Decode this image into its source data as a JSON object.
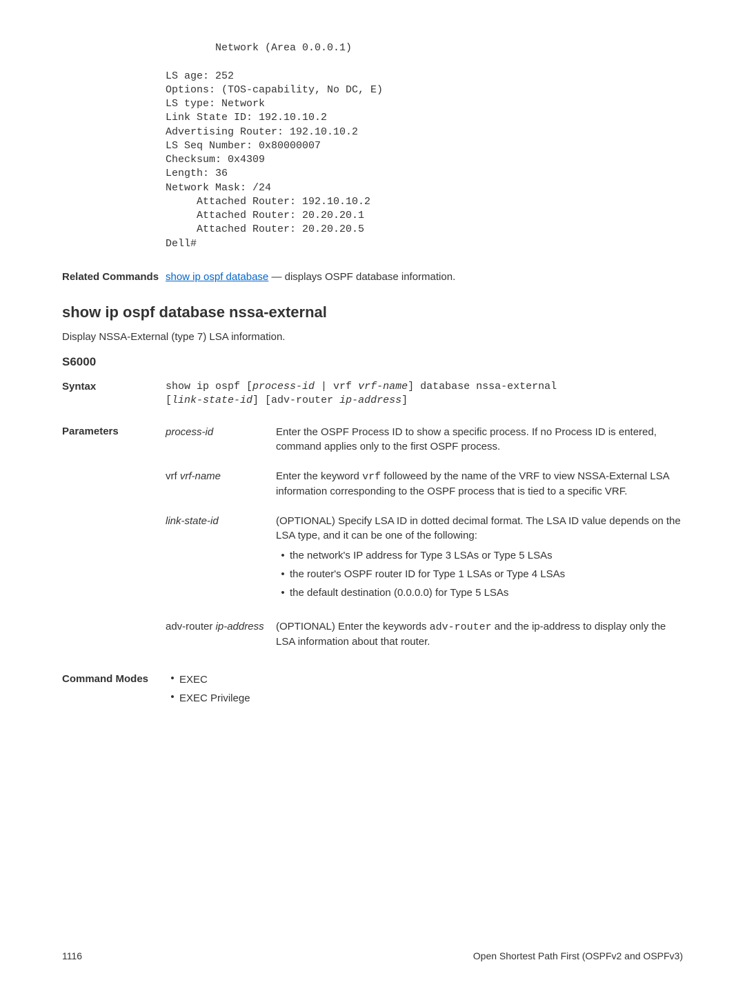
{
  "codeBlock": "        Network (Area 0.0.0.1)\n\nLS age: 252\nOptions: (TOS-capability, No DC, E)\nLS type: Network\nLink State ID: 192.10.10.2\nAdvertising Router: 192.10.10.2\nLS Seq Number: 0x80000007\nChecksum: 0x4309\nLength: 36\nNetwork Mask: /24\n     Attached Router: 192.10.10.2\n     Attached Router: 20.20.20.1\n     Attached Router: 20.20.20.5\nDell#",
  "related": {
    "label": "Related Commands",
    "linkText": "show ip ospf database",
    "restText": " — displays OSPF database information."
  },
  "section": {
    "heading": "show ip ospf database nssa-external",
    "desc": "Display NSSA-External (type 7) LSA information.",
    "subheading": "S6000"
  },
  "syntax": {
    "label": "Syntax",
    "part1": "show ip ospf [",
    "part2_italic": "process-id",
    "part3": " | vrf ",
    "part4_italic": "vrf-name",
    "part5": "] database nssa-external",
    "line2a": "[",
    "line2b_italic": "link-state-id",
    "line2c": "] [adv-router ",
    "line2d_italic": "ip-address",
    "line2e": "]"
  },
  "parameters": {
    "label": "Parameters",
    "items": [
      {
        "nameItalic": "process-id",
        "desc": "Enter the OSPF Process ID to show a specific process. If no Process ID is entered, command applies only to the first OSPF process."
      },
      {
        "namePlain": "vrf ",
        "nameItalic": "vrf-name",
        "descPre": "Enter the keyword ",
        "descMono": "vrf",
        "descPost": " followeed by the name of the VRF to view NSSA-External LSA information corresponding to the OSPF process that is tied to a specific VRF."
      },
      {
        "nameItalic": "link-state-id",
        "desc": "(OPTIONAL) Specify LSA ID in dotted decimal format. The LSA ID value depends on the LSA type, and it can be one of the following:",
        "bullets": [
          "the network's IP address for Type 3 LSAs or Type 5 LSAs",
          "the router's OSPF router ID for Type 1 LSAs or Type 4 LSAs",
          "the default destination (0.0.0.0) for Type 5 LSAs"
        ]
      },
      {
        "namePlain": "adv-router ",
        "nameItalic": "ip-address",
        "descPre": "(OPTIONAL) Enter the keywords ",
        "descMono": "adv-router",
        "descPost": " and the ip-address to display only the LSA information about that router."
      }
    ]
  },
  "commandModes": {
    "label": "Command Modes",
    "items": [
      "EXEC",
      "EXEC Privilege"
    ]
  },
  "footer": {
    "pageNum": "1116",
    "rightText": "Open Shortest Path First (OSPFv2 and OSPFv3)"
  }
}
